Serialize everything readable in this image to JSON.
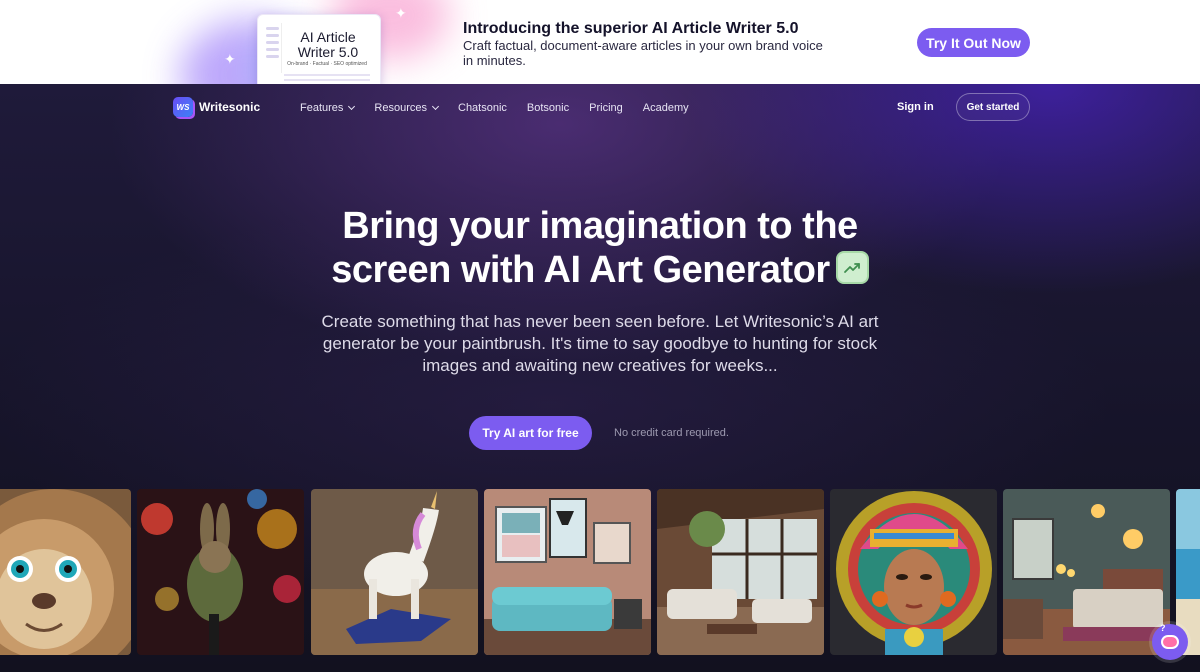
{
  "banner": {
    "card_title": "AI Article Writer 5.0",
    "card_tags": "On-brand · Factual · SEO optimized",
    "heading": "Introducing the superior AI Article Writer 5.0",
    "subtext": "Craft factual, document-aware articles in your own brand voice in minutes.",
    "cta": "Try It Out Now"
  },
  "nav": {
    "logo_mark": "WS",
    "logo_text": "Writesonic",
    "items": [
      {
        "label": "Features",
        "has_dropdown": true
      },
      {
        "label": "Resources",
        "has_dropdown": true
      },
      {
        "label": "Chatsonic",
        "has_dropdown": false
      },
      {
        "label": "Botsonic",
        "has_dropdown": false
      },
      {
        "label": "Pricing",
        "has_dropdown": false
      },
      {
        "label": "Academy",
        "has_dropdown": false
      }
    ],
    "signin": "Sign in",
    "get_started": "Get started"
  },
  "hero": {
    "headline_line1": "Bring your imagination to the",
    "headline_line2": "screen with AI Art Generator",
    "badge_icon": "trending-up-icon",
    "subtext": "Create something that has never been seen before. Let Writesonic’s AI art generator be your paintbrush. It's time to say goodbye to hunting for stock images and awaiting new creatives for weeks...",
    "cta": "Try AI art for free",
    "cta_note": "No credit card required."
  },
  "gallery": [
    "lion-image",
    "rabbit-cyclist-image",
    "unicorn-sculpture-image",
    "teal-sofa-room-image",
    "living-room-image",
    "aztec-woman-image",
    "bedroom-image",
    "beach-image"
  ],
  "colors": {
    "accent": "#7c5cf0",
    "banner_bg": "#ffffff",
    "hero_bg": "#1a1730"
  }
}
